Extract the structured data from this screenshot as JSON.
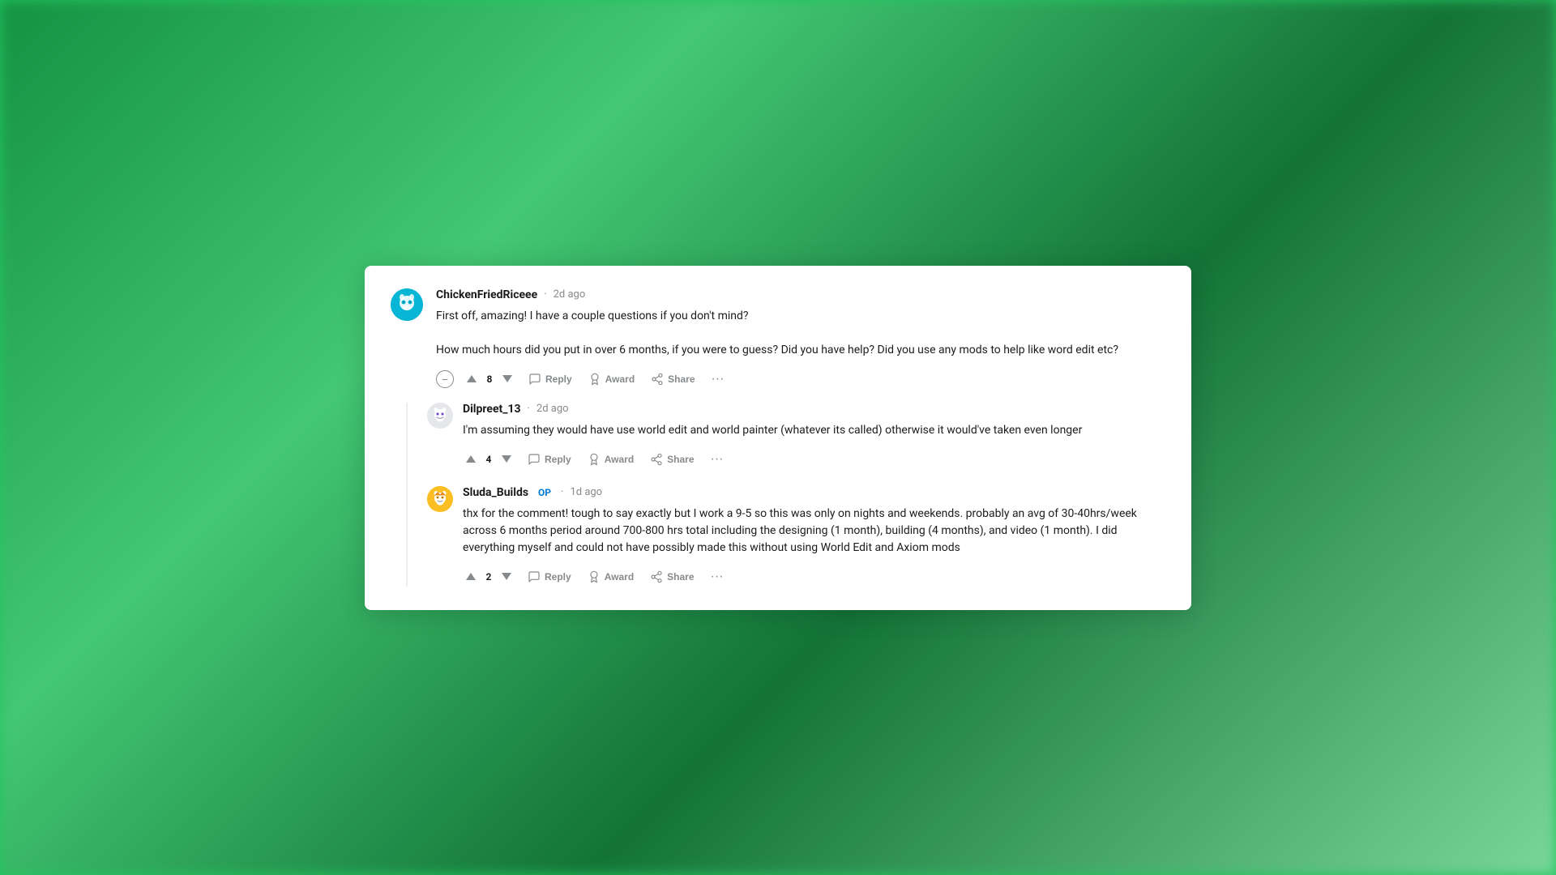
{
  "background": "#22c55e",
  "comments": [
    {
      "id": "chicken",
      "username": "ChickenFriedRiceee",
      "timestamp": "2d ago",
      "op": false,
      "avatar_color": "#06b6d4",
      "text_lines": [
        "First off, amazing! I have a couple questions if you don't mind?",
        "How much hours did you put in over 6 months, if you were to guess? Did you have help? Did you use any mods to help like word edit etc?"
      ],
      "votes": 8,
      "actions": [
        "Reply",
        "Award",
        "Share"
      ]
    }
  ],
  "replies": [
    {
      "id": "dilpreet",
      "username": "Dilpreet_13",
      "timestamp": "2d ago",
      "op": false,
      "avatar_color": "#d1d5db",
      "text": "I'm assuming they would have use world edit and world painter (whatever its called) otherwise it would've taken even longer",
      "votes": 4,
      "actions": [
        "Reply",
        "Award",
        "Share"
      ]
    },
    {
      "id": "sluda",
      "username": "Sluda_Builds",
      "timestamp": "1d ago",
      "op": true,
      "avatar_color": "#fbbf24",
      "text": "thx for the comment! tough to say exactly but I work a 9-5 so this was only on nights and weekends. probably an avg of 30-40hrs/week across 6 months period around 700-800 hrs total including the designing (1 month), building (4 months), and video (1 month). I did everything myself and could not have possibly made this without using World Edit and Axiom mods",
      "votes": 2,
      "actions": [
        "Reply",
        "Award",
        "Share"
      ]
    }
  ],
  "labels": {
    "reply": "Reply",
    "award": "Award",
    "share": "Share",
    "op": "OP",
    "collapse_title": "Collapse thread",
    "more": "More options"
  }
}
